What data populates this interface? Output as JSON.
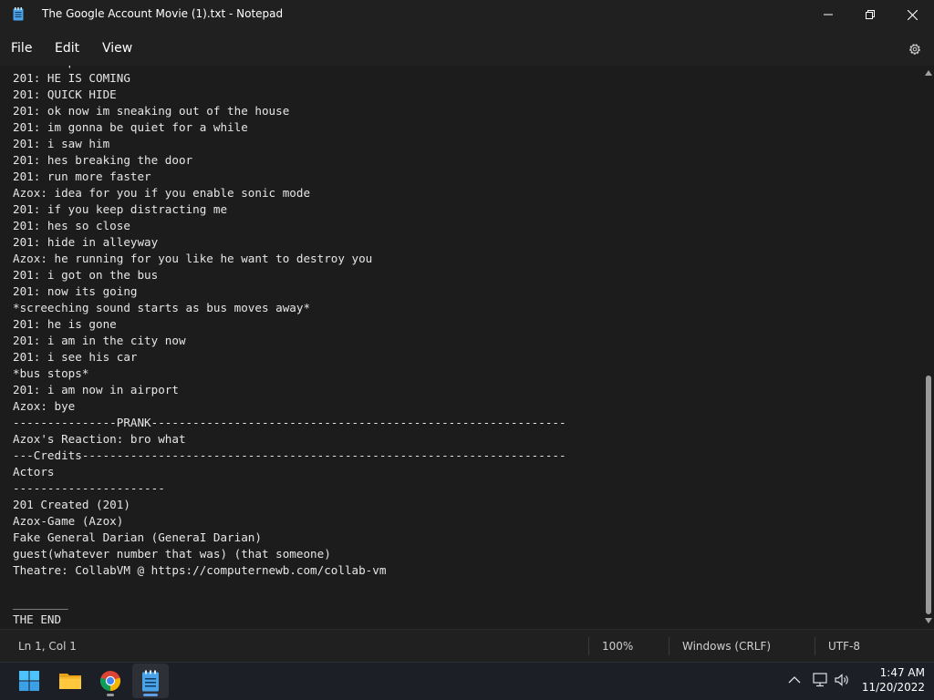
{
  "window": {
    "title": "The Google Account Movie (1).txt - Notepad",
    "icon": "notepad-icon"
  },
  "menu": {
    "file": "File",
    "edit": "Edit",
    "view": "View",
    "settings_icon": "gear-icon"
  },
  "editor": {
    "lines": [
      "*footsteps",
      "201: HE IS COMING",
      "201: QUICK HIDE",
      "201: ok now im sneaking out of the house",
      "201: im gonna be quiet for a while",
      "201: i saw him",
      "201: hes breaking the door",
      "201: run more faster",
      "Azox: idea for you if you enable sonic mode",
      "201: if you keep distracting me",
      "201: hes so close",
      "201: hide in alleyway",
      "Azox: he running for you like he want to destroy you",
      "201: i got on the bus",
      "201: now its going",
      "*screeching sound starts as bus moves away*",
      "201: he is gone",
      "201: i am in the city now",
      "201: i see his car",
      "*bus stops*",
      "201: i am now in airport",
      "Azox: bye",
      "---------------PRANK------------------------------------------------------------",
      "Azox's Reaction: bro what",
      "---Credits----------------------------------------------------------------------",
      "Actors",
      "----------------------",
      "201 Created (201)",
      "Azox-Game (Azox)",
      "Fake General Darian (GeneraI Darian)",
      "guest(whatever number that was) (that someone)",
      "Theatre: CollabVM @ https://computernewb.com/collab-vm",
      "",
      "________",
      "THE END"
    ]
  },
  "status": {
    "position": "Ln 1, Col 1",
    "zoom": "100%",
    "line_ending": "Windows (CRLF)",
    "encoding": "UTF-8"
  },
  "taskbar": {
    "apps": [
      "start-icon",
      "file-explorer-icon",
      "chrome-icon",
      "notepad-icon"
    ],
    "time": "1:47 AM",
    "date": "11/20/2022"
  },
  "colors": {
    "background": "#202020",
    "editor_bg": "#1c1c1c",
    "text": "#e6e6e6",
    "accent": "#5ea0e8"
  }
}
